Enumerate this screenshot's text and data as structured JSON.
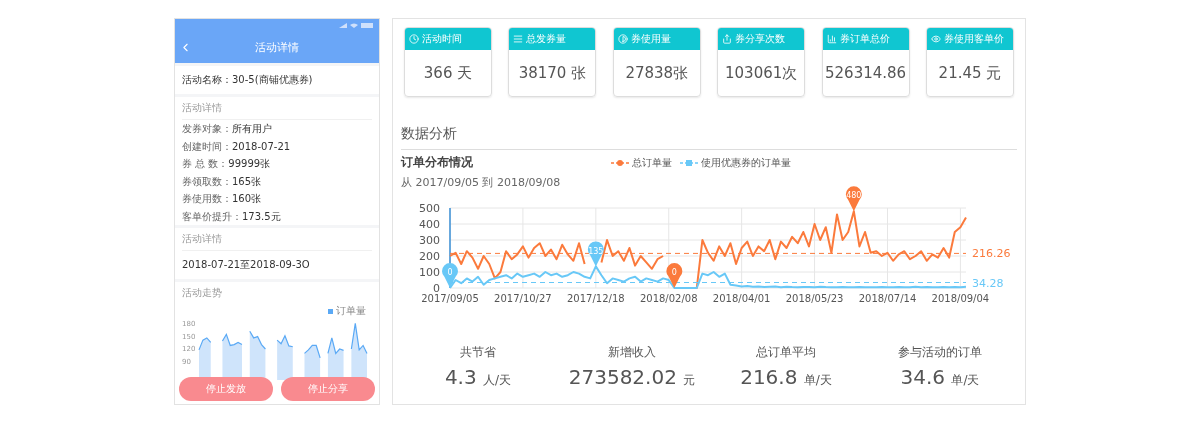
{
  "phone": {
    "title": "活动详情",
    "name_row": {
      "label": "活动名称：",
      "value": "30-5(商铺优惠券)"
    },
    "details_heading": "活动详情",
    "details": [
      {
        "label": "发券对象：",
        "value": "所有用户"
      },
      {
        "label": "创建时间：",
        "value": "2018-07-21"
      },
      {
        "label": "券 总 数：",
        "value": "99999张"
      },
      {
        "label": "券领取数：",
        "value": "165张"
      },
      {
        "label": "券使用数：",
        "value": "160张"
      },
      {
        "label": "客单价提升：",
        "value": "173.5元"
      }
    ],
    "period_heading": "活动详情",
    "period": "2018-07-21至2018-09-3O",
    "trend_heading": "活动走势",
    "trend_legend": "订单量",
    "trend_axis_labels": [
      "180",
      "150",
      "120",
      "90"
    ],
    "buttons": [
      {
        "label": "停止发放"
      },
      {
        "label": "停止分享"
      }
    ]
  },
  "cards": [
    {
      "label": "活动时间",
      "value": "366 天",
      "kind": "clock"
    },
    {
      "label": "总发券量",
      "value": "38170 张",
      "kind": "list"
    },
    {
      "label": "券使用量",
      "value": "27838张",
      "kind": "half"
    },
    {
      "label": "券分享次数",
      "value": "103061次",
      "kind": "share"
    },
    {
      "label": "券订单总价",
      "value": "526314.86",
      "kind": "bars"
    },
    {
      "label": "券使用客单价",
      "value": "21.45 元",
      "kind": "eye"
    }
  ],
  "section_title": "数据分析",
  "order_chart": {
    "subtitle": "从 2017/09/05 到 2018/09/08",
    "chart_data": {
      "type": "line",
      "title": "订单分布情况",
      "categories": [
        "2017/09/05",
        null,
        null,
        null,
        null,
        null,
        null,
        null,
        null,
        null,
        null,
        null,
        null,
        "2017/10/27",
        null,
        null,
        null,
        null,
        null,
        null,
        null,
        null,
        null,
        null,
        null,
        null,
        "2017/12/18",
        null,
        null,
        null,
        null,
        null,
        null,
        null,
        null,
        null,
        null,
        null,
        null,
        "2018/02/08",
        null,
        null,
        null,
        null,
        null,
        null,
        null,
        null,
        null,
        null,
        null,
        null,
        "2018/04/01",
        null,
        null,
        null,
        null,
        null,
        null,
        null,
        null,
        null,
        null,
        null,
        null,
        "2018/05/23",
        null,
        null,
        null,
        null,
        null,
        null,
        null,
        null,
        null,
        null,
        null,
        null,
        "2018/07/14",
        null,
        null,
        null,
        null,
        null,
        null,
        null,
        null,
        null,
        null,
        null,
        null,
        "2018/09/04",
        null
      ],
      "series": [
        {
          "name": "总订单量",
          "color": "#fb7a3c",
          "values": [
            200,
            220,
            150,
            230,
            190,
            120,
            200,
            150,
            60,
            100,
            230,
            180,
            210,
            260,
            190,
            250,
            280,
            200,
            240,
            180,
            270,
            210,
            170,
            280,
            150,
            null,
            null,
            160,
            300,
            200,
            230,
            170,
            250,
            140,
            200,
            160,
            120,
            180,
            200,
            null,
            0,
            0,
            0,
            0,
            0,
            300,
            220,
            170,
            260,
            200,
            280,
            150,
            250,
            290,
            200,
            260,
            230,
            300,
            180,
            290,
            250,
            320,
            280,
            350,
            260,
            400,
            300,
            380,
            220,
            460,
            300,
            350,
            480,
            260,
            350,
            220,
            230,
            200,
            220,
            170,
            210,
            230,
            180,
            200,
            230,
            170,
            210,
            190,
            250,
            190,
            350,
            380,
            440
          ]
        },
        {
          "name": "使用优惠券的订单量",
          "color": "#68c8f7",
          "values": [
            0,
            50,
            30,
            60,
            40,
            70,
            20,
            50,
            60,
            70,
            80,
            60,
            90,
            70,
            80,
            90,
            70,
            100,
            80,
            90,
            70,
            80,
            100,
            90,
            70,
            60,
            135,
            80,
            30,
            60,
            50,
            40,
            60,
            70,
            40,
            60,
            50,
            40,
            60,
            50,
            0,
            0,
            0,
            0,
            0,
            90,
            80,
            100,
            70,
            90,
            20,
            15,
            10,
            12,
            8,
            10,
            6,
            8,
            10,
            5,
            8,
            6,
            5,
            7,
            6,
            5,
            8,
            6,
            5,
            4,
            6,
            5,
            4,
            6,
            5,
            4,
            5,
            6,
            4,
            5,
            6,
            4,
            5,
            8,
            5,
            6,
            4,
            5,
            6,
            5,
            6,
            5,
            8
          ]
        }
      ],
      "ylim": [
        0,
        500
      ],
      "yticks": [
        0,
        100,
        200,
        300,
        400,
        500
      ],
      "grid": true,
      "ref_lines": [
        {
          "axis": "y",
          "value": 216.26,
          "label": "216.26"
        },
        {
          "axis": "y",
          "value": 34.28,
          "label": "34.28"
        }
      ],
      "annotations": [
        "0",
        "135",
        "0",
        "480"
      ]
    }
  },
  "stats": [
    {
      "label": "共节省",
      "value": "4.3",
      "unit": "人/天"
    },
    {
      "label": "新增收入",
      "value": "273582.02",
      "unit": "元"
    },
    {
      "label": "总订单平均",
      "value": "216.8",
      "unit": "单/天"
    },
    {
      "label": "参与活动的订单",
      "value": "34.6",
      "unit": "单/天"
    }
  ]
}
